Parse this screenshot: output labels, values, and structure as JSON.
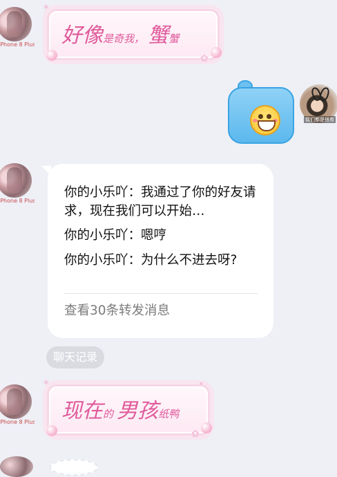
{
  "avatars": {
    "left_caption": "iPhone 8 Plus",
    "right_caption": "我们都是很有"
  },
  "messages": [
    {
      "type": "fancy_text",
      "main": "好像",
      "small1": "是",
      "small2": "奇我，",
      "main2": "蟹",
      "small3": "蟹"
    },
    {
      "type": "sticker",
      "name": "grinning-face-sticker"
    },
    {
      "type": "forwarded_chat",
      "lines": [
        "你的小乐吖：我通过了你的好友请求，现在我们可以开始…",
        "你的小乐吖：嗯哼",
        "你的小乐吖：为什么不进去呀?"
      ],
      "footer": "查看30条转发消息"
    },
    {
      "type": "tag",
      "label": "聊天记录"
    },
    {
      "type": "fancy_text",
      "main": "现在",
      "small1": "的",
      "main2": "男孩",
      "small2": "纸鸭"
    }
  ],
  "colors": {
    "background": "#eef0f6",
    "fancy_text": "#e05a9b",
    "card": "#ffffff",
    "footer_text": "#7c7c7c"
  }
}
